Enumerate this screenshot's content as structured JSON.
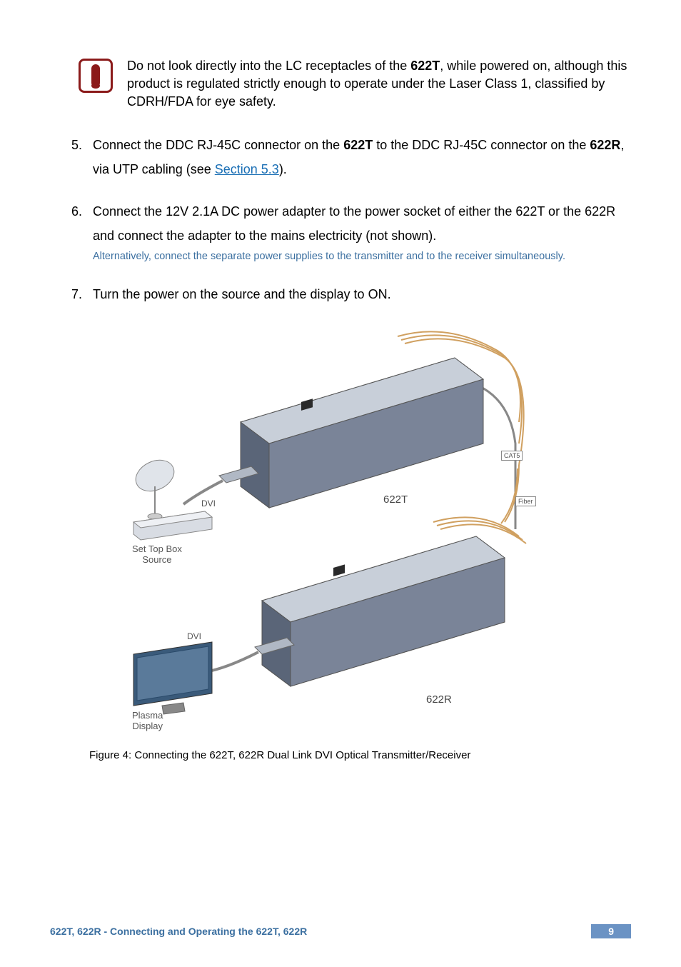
{
  "warning": {
    "text_parts": [
      "Do not look directly into the LC receptacles of the ",
      "622T",
      ", while powered on, although this product is regulated strictly enough to operate under the Laser Class 1, classified by CDRH/FDA for eye safety."
    ]
  },
  "items": {
    "five": {
      "num": "5.",
      "p1": "Connect the DDC RJ-45C connector on the ",
      "b1": "622T",
      "p2": " to the DDC RJ-45C connector on the ",
      "b2": "622R",
      "p3": ", via UTP cabling (see ",
      "link": "Section 5.3",
      "p4": ")."
    },
    "six": {
      "num": "6.",
      "text": "Connect the 12V 2.1A DC power adapter to the power socket of either the 622T or the 622R and connect the adapter to the mains electricity (not shown).",
      "note": "Alternatively, connect the separate power supplies to the transmitter and to the receiver simultaneously."
    },
    "seven": {
      "num": "7.",
      "text": "Turn the power on the source and the display to ON."
    }
  },
  "diagram": {
    "labels": {
      "cat5": "CAT5",
      "fiber": "Fiber",
      "dvi1": "DVI",
      "dvi2": "DVI",
      "device1": "622T",
      "device2": "622R",
      "source": "Set Top Box\nSource",
      "display": "Plasma\nDisplay"
    }
  },
  "figure_caption": "Figure 4: Connecting the 622T, 622R Dual Link DVI Optical Transmitter/Receiver",
  "footer": {
    "left": "622T, 622R - Connecting and Operating the 622T, 622R",
    "page": "9"
  }
}
